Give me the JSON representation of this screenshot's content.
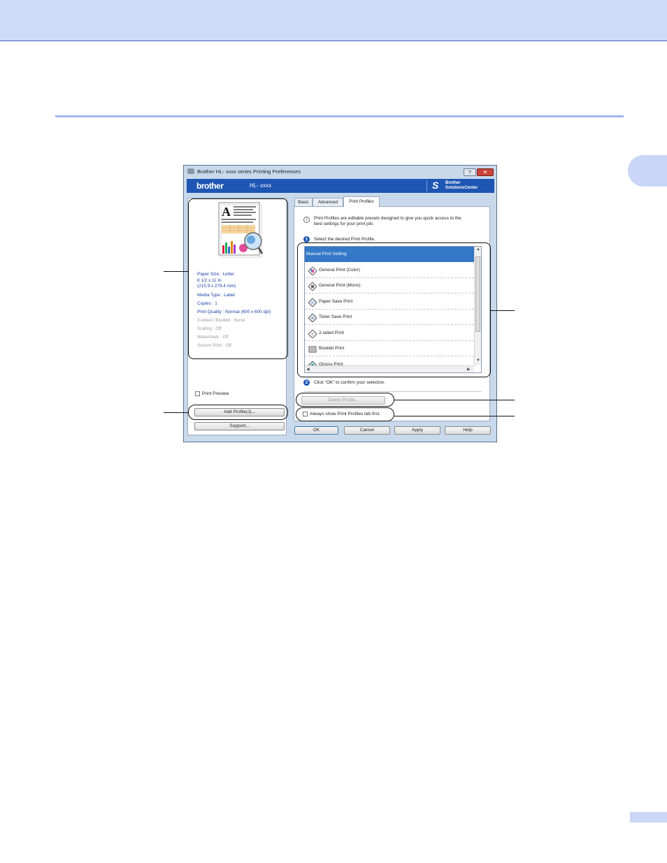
{
  "dialog": {
    "title": "Brother HL- xxxx  series Printing Preferences",
    "help_button": "?",
    "close_button": "✕",
    "brand": {
      "logo": "brother",
      "model": "HL- xxxx",
      "solutions_line1": "Brother",
      "solutions_line2": "SolutionsCenter"
    },
    "settings_summary": [
      {
        "text": "Paper Size : Letter",
        "state": "active"
      },
      {
        "text": "8 1/2 x 11 in",
        "state": "active"
      },
      {
        "text": "(215.9 x 279.4 mm)",
        "state": "active"
      },
      {
        "text": "Media Type : Label",
        "state": "active"
      },
      {
        "text": "Copies : 1",
        "state": "active"
      },
      {
        "text": "Print Quality : Normal (600 x 600 dpi)",
        "state": "active"
      },
      {
        "text": "2-sided / Booklet : None",
        "state": "disabled"
      },
      {
        "text": "Scaling : Off",
        "state": "disabled"
      },
      {
        "text": "Watermark : Off",
        "state": "disabled"
      },
      {
        "text": "Secure Print : Off",
        "state": "disabled"
      }
    ],
    "print_preview_label": "Print Preview",
    "add_profile_button": "Add Profile(J)...",
    "support_button": "Support...",
    "tabs": [
      {
        "label": "Basic",
        "active": false
      },
      {
        "label": "Advanced",
        "active": false
      },
      {
        "label": "Print Profiles",
        "active": true
      }
    ],
    "intro_line1": "Print Profiles are editable presets designed to give you quick access to the",
    "intro_line2": "best settings for your print job.",
    "step1_number": "1",
    "step1_text": "Select the desired Print Profile.",
    "profiles": [
      {
        "label": "Manual Print Setting",
        "selected": true,
        "icon": "none"
      },
      {
        "label": "General Print (Color)",
        "selected": false,
        "icon": "color-diamond-icon"
      },
      {
        "label": "General Print (Mono)",
        "selected": false,
        "icon": "mono-diamond-icon"
      },
      {
        "label": "Paper Save Print",
        "selected": false,
        "icon": "paper-save-icon"
      },
      {
        "label": "Toner Save Print",
        "selected": false,
        "icon": "toner-save-icon"
      },
      {
        "label": "2-sided Print",
        "selected": false,
        "icon": "two-sided-icon"
      },
      {
        "label": "Booklet Print",
        "selected": false,
        "icon": "booklet-icon"
      },
      {
        "label": "Glossy Print",
        "selected": false,
        "icon": "glossy-icon"
      }
    ],
    "step2_number": "2",
    "step2_text": "Click \"OK\" to confirm your selection.",
    "delete_profile_button": "Delete Profile...",
    "always_show_label": "Always show Print Profiles tab first.",
    "footer_buttons": {
      "ok": "OK",
      "cancel": "Cancel",
      "apply": "Apply",
      "help": "Help"
    }
  },
  "colors": {
    "header_band": "#cfdcf9",
    "accent_rule": "#a3b5f0",
    "brand_bar": "#1e56b4",
    "selection": "#3478c8",
    "info_text_blue": "#1b3fa8"
  }
}
